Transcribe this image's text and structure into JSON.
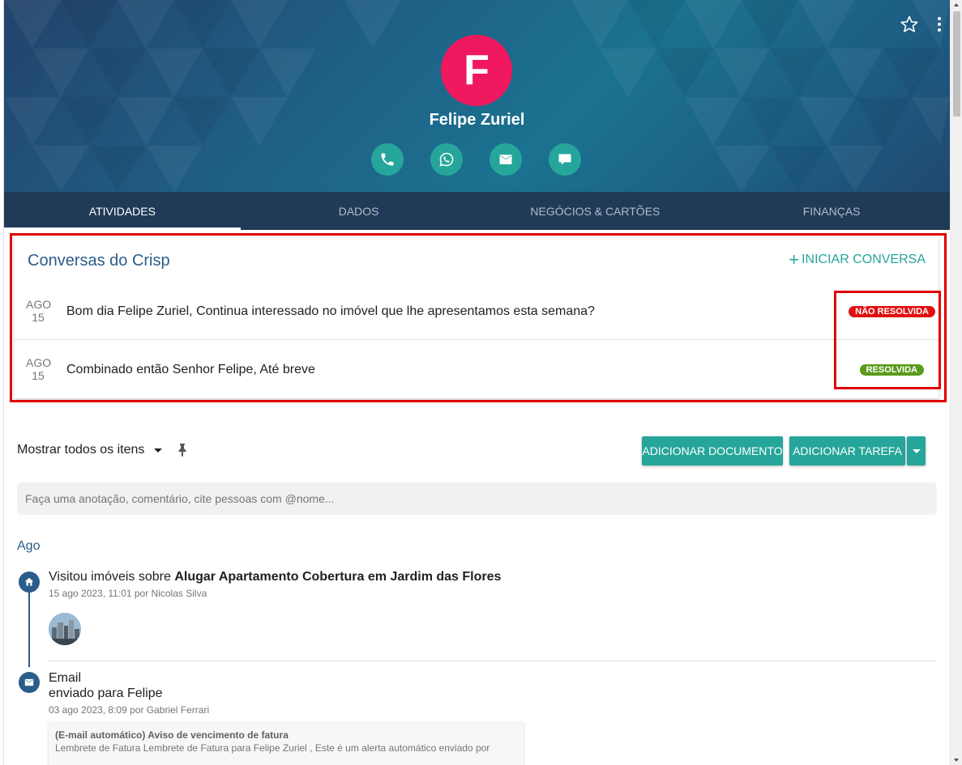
{
  "contact": {
    "initial": "F",
    "name": "Felipe Zuriel",
    "avatar_color": "#f0185e"
  },
  "header_actions": {
    "favorite_icon": "star-outline-icon",
    "more_icon": "more-vert-icon"
  },
  "contact_actions": [
    {
      "icon": "phone-icon"
    },
    {
      "icon": "whatsapp-icon"
    },
    {
      "icon": "email-icon"
    },
    {
      "icon": "chat-icon"
    }
  ],
  "tabs": [
    {
      "label": "ATIVIDADES",
      "active": true
    },
    {
      "label": "DADOS",
      "active": false
    },
    {
      "label": "NEGÓCIOS & CARTÕES",
      "active": false
    },
    {
      "label": "FINANÇAS",
      "active": false
    }
  ],
  "crisp": {
    "title": "Conversas do Crisp",
    "start_label": "INICIAR CONVERSA",
    "start_icon": "plus-icon",
    "conversations": [
      {
        "month": "AGO",
        "day": "15",
        "text": "Bom dia Felipe Zuriel, Continua interessado no imóvel que lhe apresentamos esta semana?",
        "status": "NÃO RESOLVIDA",
        "status_color": "#e01010"
      },
      {
        "month": "AGO",
        "day": "15",
        "text": "Combinado então Senhor Felipe, Até breve",
        "status": "RESOLVIDA",
        "status_color": "#5a9a1a"
      }
    ]
  },
  "toolbar": {
    "filter_label": "Mostrar todos os itens",
    "pin_icon": "pin-icon",
    "add_document_label": "ADICIONAR DOCUMENTO",
    "add_task_label": "ADICIONAR TAREFA",
    "accent_color": "#26a69a"
  },
  "note": {
    "placeholder": "Faça uma anotação, comentário, cite pessoas com @nome..."
  },
  "timeline": {
    "month": "Ago",
    "items": [
      {
        "icon": "home-icon",
        "prefix": "Visitou imóveis sobre ",
        "bold": "Alugar Apartamento Cobertura em Jardim das Flores",
        "meta": "15 ago 2023, 11:01 por Nicolas Silva"
      },
      {
        "icon": "mail-icon",
        "title_line1": "Email",
        "title_line2": "enviado para Felipe",
        "meta": "03 ago 2023, 8:09 por Gabriel Ferrari",
        "subject": "(E-mail automático) Aviso de vencimento de fatura",
        "preview": "Lembrete de Fatura Lembrete de Fatura para Felipe Zuriel , Este é um alerta automático enviado por"
      }
    ]
  }
}
